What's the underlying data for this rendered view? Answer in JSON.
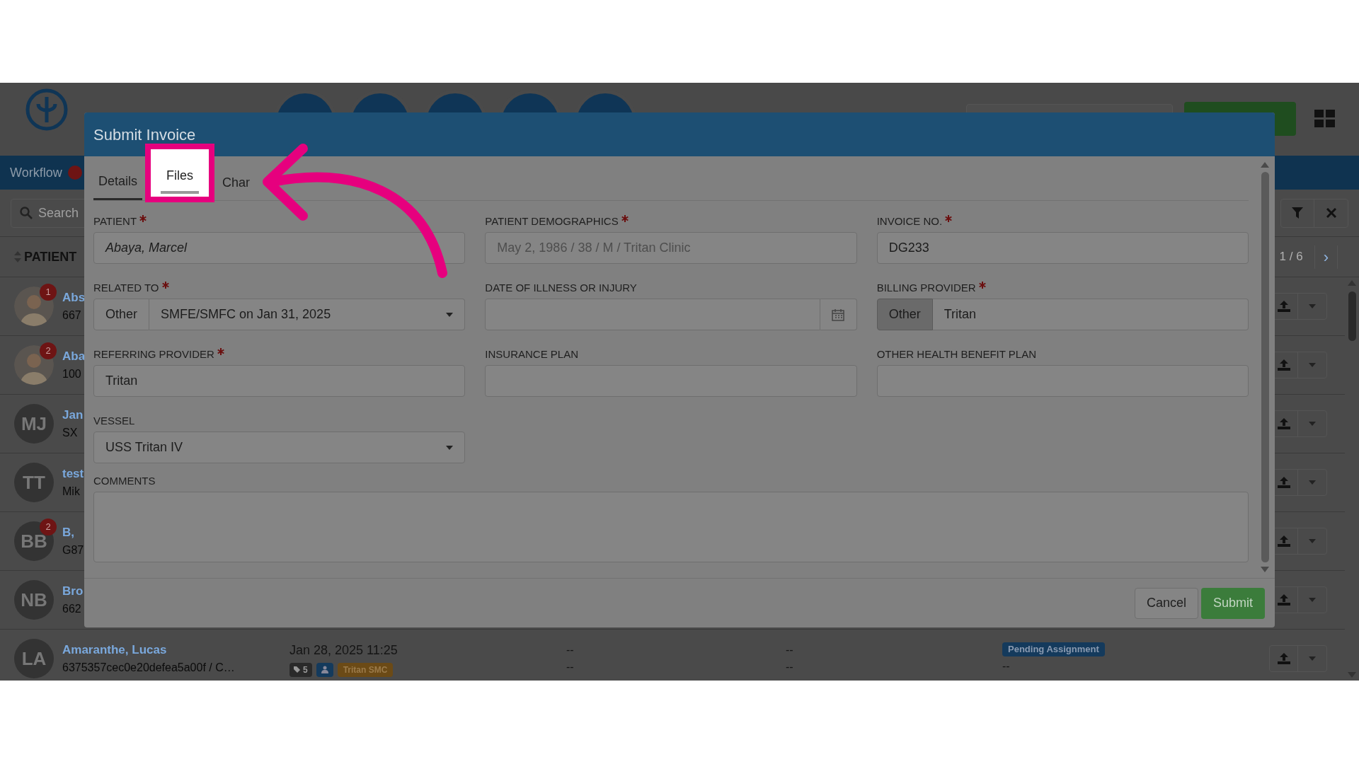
{
  "app": {
    "nav_tab": "Workflow",
    "search_placeholder": "Search",
    "column_header": "PATIENT",
    "pager": "1 / 6",
    "next": "›",
    "rows": [
      {
        "badge": "1",
        "name": "Abs",
        "sub": "667"
      },
      {
        "badge": "2",
        "name": "Aba",
        "sub": "100"
      },
      {
        "kind": "initials",
        "initials": "MJ",
        "name": "Jan",
        "sub": "SX"
      },
      {
        "kind": "initials",
        "initials": "TT",
        "name": "test",
        "sub": "Mik"
      },
      {
        "kind": "initials",
        "initials": "BB",
        "badge": "2",
        "name": "B,",
        "sub": "G87"
      },
      {
        "kind": "initials",
        "initials": "NB",
        "name": "Bro",
        "sub": "662"
      },
      {
        "kind": "initials",
        "initials": "LA",
        "name": "Amaranthe, Lucas",
        "sub": "6375357cec0e20defea5a00f / C…",
        "date": "Jan 28, 2025 11:25",
        "tags": [
          {
            "kind": "count",
            "text": "5"
          },
          {
            "kind": "person"
          },
          {
            "kind": "label",
            "text": "Tritan SMC"
          }
        ],
        "col_3": [
          "--",
          "--"
        ],
        "col_4": [
          "--",
          "--"
        ],
        "status": "Pending Assignment",
        "status_sub": "--"
      }
    ]
  },
  "dialog": {
    "title": "Submit Invoice",
    "tabs": [
      {
        "label": "Details",
        "selected": true,
        "highlighted": false
      },
      {
        "label": "Files",
        "selected": false,
        "highlighted": true
      },
      {
        "label": "Char",
        "selected": false,
        "highlighted": false
      }
    ],
    "fields": [
      {
        "label": "PATIENT",
        "required": true,
        "kind": "name",
        "value": "Abaya, Marcel"
      },
      {
        "label": "PATIENT DEMOGRAPHICS",
        "required": true,
        "kind": "readonly",
        "value": "May 2, 1986 / 38 / M / Tritan Clinic"
      },
      {
        "label": "INVOICE NO.",
        "required": true,
        "kind": "text",
        "value": "DG233"
      },
      {
        "label": "RELATED TO",
        "required": true,
        "kind": "addon-select",
        "addon": "Other",
        "addon_active": false,
        "value": "SMFE/SMFC on Jan 31, 2025"
      },
      {
        "label": "DATE OF ILLNESS OR INJURY",
        "required": false,
        "kind": "date"
      },
      {
        "label": "BILLING PROVIDER",
        "required": true,
        "kind": "addon-text",
        "addon": "Other",
        "addon_active": true,
        "value": "Tritan"
      },
      {
        "label": "REFERRING PROVIDER",
        "required": true,
        "kind": "text",
        "value": "Tritan"
      },
      {
        "label": "INSURANCE PLAN",
        "required": false,
        "kind": "text"
      },
      {
        "label": "OTHER HEALTH BENEFIT PLAN",
        "required": false,
        "kind": "text"
      },
      {
        "label": "VESSEL",
        "required": false,
        "kind": "select",
        "value": "USS Tritan IV"
      }
    ],
    "comments": {
      "label": "COMMENTS"
    },
    "buttons": [
      {
        "label": "Cancel",
        "kind": "secondary"
      },
      {
        "label": "Submit",
        "kind": "primary"
      }
    ]
  }
}
